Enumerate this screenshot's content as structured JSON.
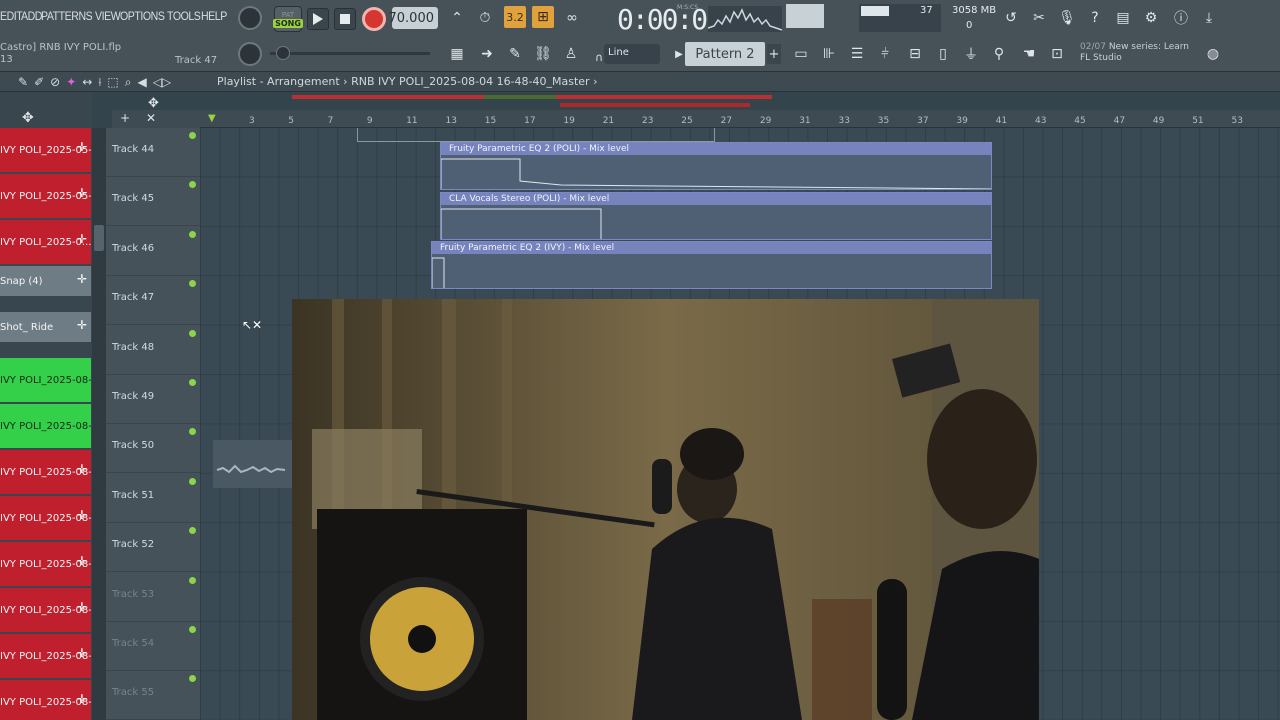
{
  "menu": [
    "EDIT",
    "ADD",
    "PATTERNS",
    "VIEW",
    "OPTIONS",
    "TOOLS",
    "HELP"
  ],
  "project": {
    "author": "Castro]",
    "file": "RNB IVY POLI.flp",
    "num": "13",
    "track": "Track 47"
  },
  "transport": {
    "mode_pat": "PAT",
    "mode_song": "SONG",
    "tempo": "70.000",
    "time": "0:00:00",
    "time_unit": "M:S:CS"
  },
  "cpu": {
    "value": "37",
    "memory": "3058 MB",
    "poly": "0"
  },
  "toolbar": {
    "snap": "Line",
    "pattern": "Pattern 2",
    "pattern_add": "+"
  },
  "news": {
    "date": "02/07",
    "text": "New series: Learn",
    "source": "FL Studio"
  },
  "playlist": {
    "title": "Playlist - Arrangement",
    "sep": "›",
    "path": "RNB IVY POLI_2025-08-04 16-48-40_Master",
    "end": "›"
  },
  "ruler": [
    "3",
    "5",
    "7",
    "9",
    "11",
    "13",
    "15",
    "17",
    "19",
    "21",
    "23",
    "25",
    "27",
    "29",
    "31",
    "33",
    "35",
    "37",
    "39",
    "41",
    "43",
    "45",
    "47",
    "49",
    "51",
    "53"
  ],
  "clips": [
    {
      "label": "IVY POLI_2025-05-1...",
      "kind": "red"
    },
    {
      "label": "IVY POLI_2025-05-1...",
      "kind": "red"
    },
    {
      "label": "IVY POLI_2025-0...",
      "kind": "red"
    },
    {
      "label": "Snap (4)",
      "kind": "gray"
    },
    {
      "label": "Shot_ Ride",
      "kind": "gray"
    },
    {
      "label": "IVY POLI_2025-08-0...",
      "kind": "green"
    },
    {
      "label": "IVY POLI_2025-08-0...",
      "kind": "green"
    },
    {
      "label": "IVY POLI_2025-08-1...",
      "kind": "red"
    },
    {
      "label": "IVY POLI_2025-08-1...",
      "kind": "red"
    },
    {
      "label": "IVY POLI_2025-08-1...",
      "kind": "red"
    },
    {
      "label": "IVY POLI_2025-08-1...",
      "kind": "red"
    },
    {
      "label": "IVY POLI_2025-08-1...",
      "kind": "red"
    },
    {
      "label": "IVY POLI_2025-08-1...",
      "kind": "red"
    }
  ],
  "tracks": [
    {
      "label": "Track 44",
      "dim": false
    },
    {
      "label": "Track 45",
      "dim": false
    },
    {
      "label": "Track 46",
      "dim": false
    },
    {
      "label": "Track 47",
      "dim": false
    },
    {
      "label": "Track 48",
      "dim": false
    },
    {
      "label": "Track 49",
      "dim": false
    },
    {
      "label": "Track 50",
      "dim": false
    },
    {
      "label": "Track 51",
      "dim": false
    },
    {
      "label": "Track 52",
      "dim": false
    },
    {
      "label": "Track 53",
      "dim": true
    },
    {
      "label": "Track 54",
      "dim": true
    },
    {
      "label": "Track 55",
      "dim": true
    }
  ],
  "automation": [
    {
      "label": "Fruity Parametric EQ 2 (POLI) - Mix level"
    },
    {
      "label": "CLA Vocals Stereo (POLI) - Mix level"
    },
    {
      "label": "Fruity Parametric EQ 2 (IVY) - Mix level"
    }
  ],
  "colors": {
    "accent_green": "#9bd23f",
    "clip_red": "#c0202e",
    "clip_green": "#35d04a",
    "automation": "#7683bd"
  }
}
